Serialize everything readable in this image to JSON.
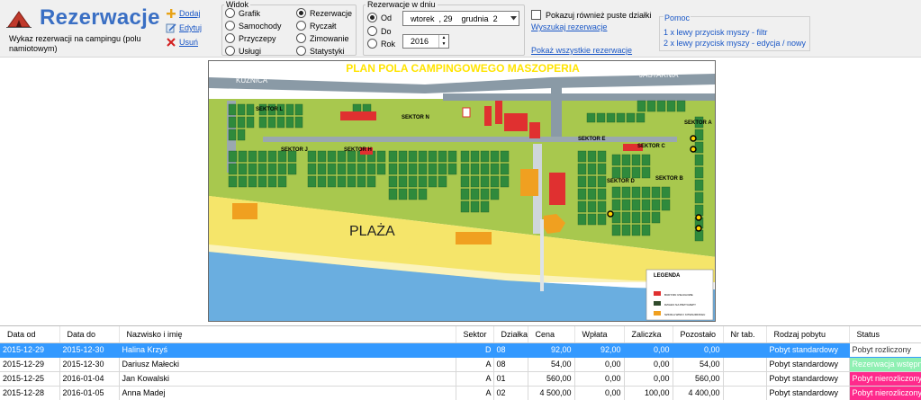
{
  "app": {
    "title": "Rezerwacje",
    "subtitle": "Wykaz rezerwacji na campingu (polu namiotowym)"
  },
  "actions": [
    {
      "label": "Dodaj",
      "icon": "plus-icon"
    },
    {
      "label": "Edytuj",
      "icon": "edit-icon"
    },
    {
      "label": "Usuń",
      "icon": "delete-icon"
    }
  ],
  "view": {
    "legend": "Widok",
    "options": [
      "Grafik",
      "Samochody",
      "Przyczepy",
      "Usługi",
      "Rezerwacje",
      "Ryczałt",
      "Zimowanie",
      "Statystyki"
    ],
    "selected": "Rezerwacje"
  },
  "date_filter": {
    "legend": "Rezerwacje w dniu",
    "options": [
      "Od",
      "Do",
      "Rok"
    ],
    "selected": "Od",
    "date_day": "wtorek",
    "date_num": ", 29",
    "date_month": "grudnia",
    "date_trunc": "2",
    "year": "2016"
  },
  "filters": {
    "show_empty_label": "Pokazuj również puste działki",
    "show_empty_checked": false,
    "search_link": "Wyszukaj rezerwacje",
    "show_all_link": "Pokaż wszystkie rezerwacje"
  },
  "help": {
    "title": "Pomoc",
    "line1": "1 x lewy przycisk myszy - filtr",
    "line2": "2 x lewy przycisk myszy - edycja / nowy"
  },
  "map": {
    "title": "PLAN POLA CAMPINGOWEGO MASZOPERIA",
    "road_left": "KUŹNICA",
    "road_right": "JASTARNIA",
    "beach": "PLAŻA",
    "sectors": [
      "SEKTOR L",
      "SEKTOR N",
      "SEKTOR J",
      "SEKTOR H",
      "SEKTOR E",
      "SEKTOR C",
      "SEKTOR D",
      "SEKTOR B",
      "SEKTOR A"
    ],
    "legend_title": "LEGENDA",
    "legend_items": [
      "BUDYNKI USŁUGOWE",
      "DZIAŁKI NA PRZYCZEPY",
      "SZKOŁA WIND I KITESURFINGU"
    ],
    "colors": {
      "grass": "#a8c84e",
      "sand": "#f5e56a",
      "sea": "#6aaee0",
      "road": "#8a9aa6",
      "plot": "#2f8a3c",
      "building": "#e03030",
      "orange": "#f0a020"
    }
  },
  "table": {
    "columns": [
      "Data od",
      "Data do",
      "Nazwisko i imię",
      "Sektor",
      "Działka",
      "Cena",
      "Wpłata",
      "Zaliczka",
      "Pozostało",
      "Nr tab.",
      "Rodzaj pobytu",
      "Status"
    ],
    "rows": [
      {
        "date_from": "2015-12-29",
        "date_to": "2015-12-30",
        "name": "Halina Krzyś",
        "sector": "D",
        "plot": "08",
        "price": "92,00",
        "paid": "92,00",
        "deposit": "0,00",
        "remaining": "0,00",
        "tab": "",
        "stay": "Pobyt standardowy",
        "status": "Pobyt rozliczony",
        "selected": true,
        "status_color": "#ffffff"
      },
      {
        "date_from": "2015-12-29",
        "date_to": "2015-12-30",
        "name": "Dariusz Małecki",
        "sector": "A",
        "plot": "08",
        "price": "54,00",
        "paid": "0,00",
        "deposit": "0,00",
        "remaining": "54,00",
        "tab": "",
        "stay": "Pobyt standardowy",
        "status": "Rezerwacja wstępna",
        "selected": false,
        "status_color": "#8ff0b3"
      },
      {
        "date_from": "2015-12-25",
        "date_to": "2016-01-04",
        "name": "Jan Kowalski",
        "sector": "A",
        "plot": "01",
        "price": "560,00",
        "paid": "0,00",
        "deposit": "0,00",
        "remaining": "560,00",
        "tab": "",
        "stay": "Pobyt standardowy",
        "status": "Pobyt nierozliczony",
        "selected": false,
        "status_color": "#ff2a8c"
      },
      {
        "date_from": "2015-12-28",
        "date_to": "2016-01-05",
        "name": "Anna Madej",
        "sector": "A",
        "plot": "02",
        "price": "4 500,00",
        "paid": "0,00",
        "deposit": "100,00",
        "remaining": "4 400,00",
        "tab": "",
        "stay": "Pobyt standardowy",
        "status": "Pobyt nierozliczony",
        "selected": false,
        "status_color": "#ff2a8c"
      }
    ]
  }
}
